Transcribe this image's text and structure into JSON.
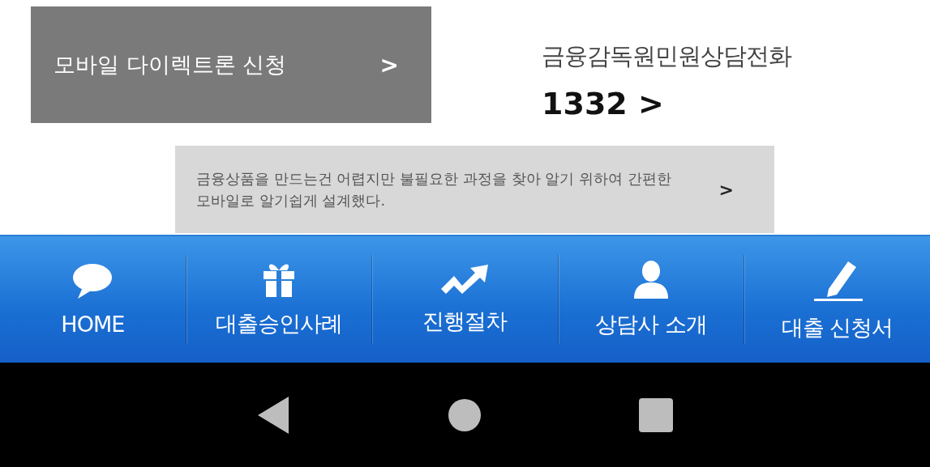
{
  "direct_loan": {
    "label": "모바일 다이렉트론 신청",
    "arrow": ">"
  },
  "hotline": {
    "title": "금융감독원민원상담전화",
    "number": "1332",
    "arrow": ">"
  },
  "banner": {
    "text": "금융상품을 만드는건 어렵지만 불필요한 과정을 찾아 알기 위하여 간편한 모바일로 알기쉽게  설계했다.",
    "arrow": ">"
  },
  "nav": [
    {
      "label": "HOME",
      "kind": "chat"
    },
    {
      "label": "대출승인사례",
      "kind": "gift"
    },
    {
      "label": "진행절차",
      "kind": "trend"
    },
    {
      "label": "상담사 소개",
      "kind": "person"
    },
    {
      "label": "대출 신청서",
      "kind": "pencil"
    }
  ]
}
